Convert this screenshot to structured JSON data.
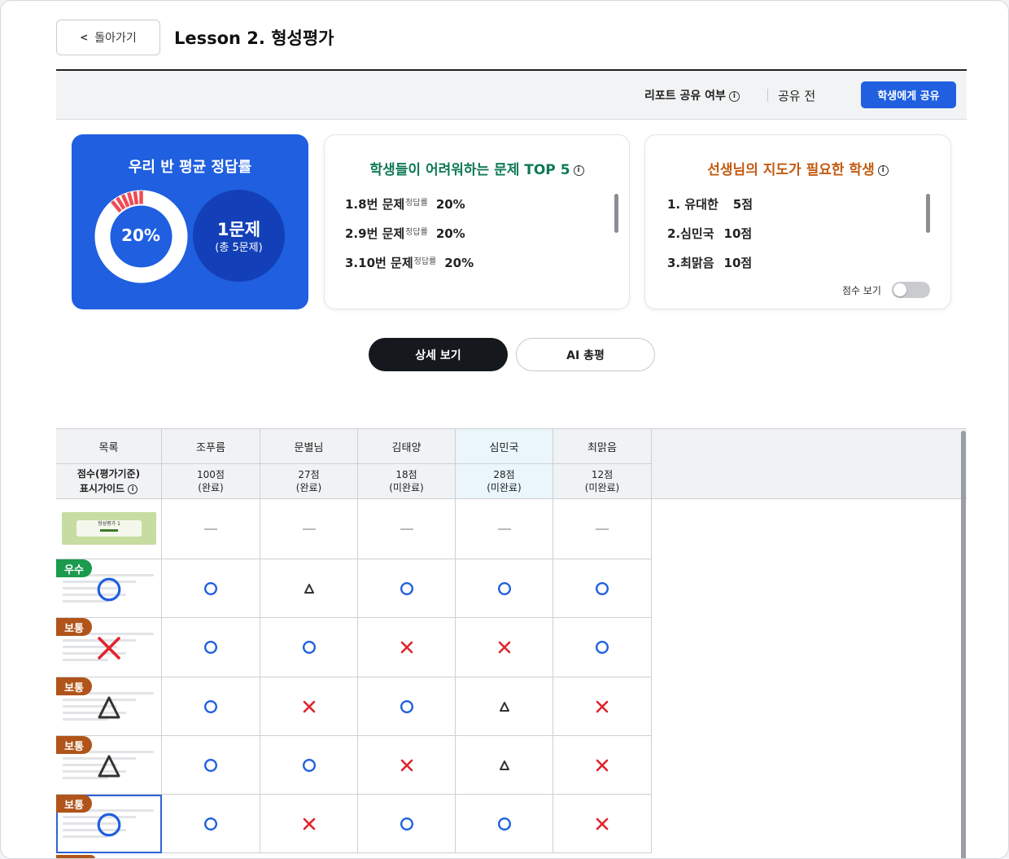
{
  "header": {
    "back_label": "돌아가기",
    "title": "Lesson 2. 형성평가"
  },
  "share": {
    "question": "리포트 공유 여부",
    "status": "공유 전",
    "button": "학생에게 공유"
  },
  "average_card": {
    "title": "우리 반 평균 정답률",
    "percent_label": "20%",
    "percent": 20,
    "wrong_count": "1문제",
    "wrong_total": "(총 5문제)"
  },
  "top5_card": {
    "title": "학생들이 어려워하는 문제 TOP 5",
    "items": [
      {
        "label": "1.8번 문제",
        "tag": "정답률",
        "rate": "20%"
      },
      {
        "label": "2.9번 문제",
        "tag": "정답률",
        "rate": "20%"
      },
      {
        "label": "3.10번 문제",
        "tag": "정답률",
        "rate": "20%"
      }
    ]
  },
  "need_card": {
    "title": "선생님의 지도가 필요한 학생",
    "items": [
      {
        "label": "1. 유대한",
        "score": "5점"
      },
      {
        "label": "2.심민국",
        "score": "10점"
      },
      {
        "label": "3.최맑음",
        "score": "10점"
      }
    ],
    "toggle_label": "점수 보기",
    "toggle_on": false
  },
  "tabs": {
    "detail": "상세 보기",
    "ai": "AI 총평"
  },
  "table": {
    "list_header": "목록",
    "score_header_line1": "점수(평가기준)",
    "score_header_line2": "표시가이드",
    "students": [
      {
        "name": "조푸름",
        "score": "100점",
        "status": "(완료)"
      },
      {
        "name": "문별님",
        "score": "27점",
        "status": "(완료)"
      },
      {
        "name": "김태양",
        "score": "18점",
        "status": "(미완료)"
      },
      {
        "name": "심민국",
        "score": "28점",
        "status": "(미완료)"
      },
      {
        "name": "최맑음",
        "score": "12점",
        "status": "(미완료)"
      }
    ],
    "questions": [
      {
        "badge": "",
        "summary": "none",
        "marks": [
          "dash",
          "dash",
          "dash",
          "dash",
          "dash"
        ]
      },
      {
        "badge": "우수",
        "summary": "o",
        "marks": [
          "o",
          "tri",
          "o",
          "o",
          "o"
        ]
      },
      {
        "badge": "보통",
        "summary": "x",
        "marks": [
          "o",
          "o",
          "x",
          "x",
          "o"
        ]
      },
      {
        "badge": "보통",
        "summary": "tri",
        "marks": [
          "o",
          "x",
          "o",
          "tri",
          "x"
        ]
      },
      {
        "badge": "보통",
        "summary": "tri",
        "marks": [
          "o",
          "o",
          "x",
          "tri",
          "x"
        ]
      },
      {
        "badge": "보통",
        "summary": "o",
        "marks": [
          "o",
          "x",
          "o",
          "o",
          "x"
        ]
      }
    ],
    "thumbnail_text": "형성평가 1"
  },
  "colors": {
    "accent": "#1f5fe0",
    "good": "#1c9a4e",
    "normal": "#b0541a",
    "o_mark": "#1f5fe0",
    "x_mark": "#e0242c"
  }
}
